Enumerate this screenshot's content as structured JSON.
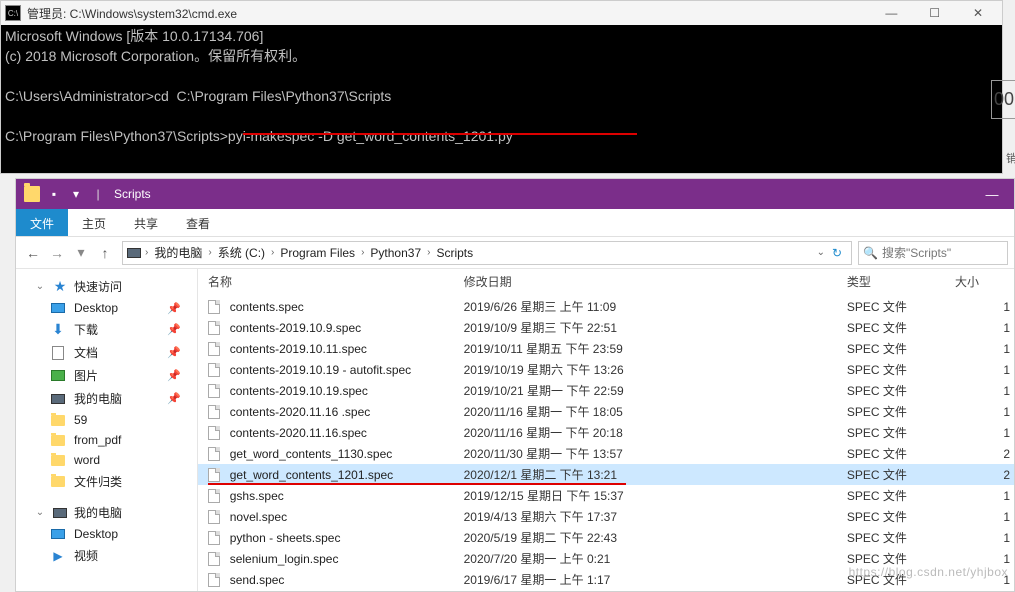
{
  "cmd": {
    "title": "管理员: C:\\Windows\\system32\\cmd.exe",
    "lines": {
      "l1": "Microsoft Windows [版本 10.0.17134.706]",
      "l2": "(c) 2018 Microsoft Corporation。保留所有权利。",
      "l3": "",
      "l4": "C:\\Users\\Administrator>cd  C:\\Program Files\\Python37\\Scripts",
      "l5": "",
      "l6": "C:\\Program Files\\Python37\\Scripts>pyi-makespec -D get_word_contents_1201.py"
    }
  },
  "right_sliver": {
    "zeros": "00",
    "undo": "销"
  },
  "explorer": {
    "title": "Scripts",
    "ribbon": {
      "file": "文件",
      "home": "主页",
      "share": "共享",
      "view": "查看"
    },
    "breadcrumb": {
      "root": "我的电脑",
      "drive": "系统 (C:)",
      "p1": "Program Files",
      "p2": "Python37",
      "p3": "Scripts"
    },
    "search_placeholder": "搜索\"Scripts\"",
    "sidebar": {
      "quick": "快速访问",
      "desktop": "Desktop",
      "downloads": "下载",
      "documents": "文档",
      "pictures": "图片",
      "mypc": "我的电脑",
      "n59": "59",
      "from_pdf": "from_pdf",
      "word": "word",
      "archive": "文件归类",
      "mypc2": "我的电脑",
      "desktop2": "Desktop",
      "video": "视频"
    },
    "columns": {
      "name": "名称",
      "date": "修改日期",
      "type": "类型",
      "size": "大小"
    },
    "files": [
      {
        "name": "contents.spec",
        "date": "2019/6/26 星期三 上午 11:09",
        "type": "SPEC 文件",
        "size": "1"
      },
      {
        "name": "contents-2019.10.9.spec",
        "date": "2019/10/9 星期三 下午 22:51",
        "type": "SPEC 文件",
        "size": "1"
      },
      {
        "name": "contents-2019.10.11.spec",
        "date": "2019/10/11 星期五 下午 23:59",
        "type": "SPEC 文件",
        "size": "1"
      },
      {
        "name": "contents-2019.10.19 - autofit.spec",
        "date": "2019/10/19 星期六 下午 13:26",
        "type": "SPEC 文件",
        "size": "1"
      },
      {
        "name": "contents-2019.10.19.spec",
        "date": "2019/10/21 星期一 下午 22:59",
        "type": "SPEC 文件",
        "size": "1"
      },
      {
        "name": "contents-2020.11.16 .spec",
        "date": "2020/11/16 星期一 下午 18:05",
        "type": "SPEC 文件",
        "size": "1"
      },
      {
        "name": "contents-2020.11.16.spec",
        "date": "2020/11/16 星期一 下午 20:18",
        "type": "SPEC 文件",
        "size": "1"
      },
      {
        "name": "get_word_contents_1130.spec",
        "date": "2020/11/30 星期一 下午 13:57",
        "type": "SPEC 文件",
        "size": "2"
      },
      {
        "name": "get_word_contents_1201.spec",
        "date": "2020/12/1 星期二 下午 13:21",
        "type": "SPEC 文件",
        "size": "2",
        "selected": true
      },
      {
        "name": "gshs.spec",
        "date": "2019/12/15 星期日 下午 15:37",
        "type": "SPEC 文件",
        "size": "1"
      },
      {
        "name": "novel.spec",
        "date": "2019/4/13 星期六 下午 17:37",
        "type": "SPEC 文件",
        "size": "1"
      },
      {
        "name": "python - sheets.spec",
        "date": "2020/5/19 星期二 下午 22:43",
        "type": "SPEC 文件",
        "size": "1"
      },
      {
        "name": "selenium_login.spec",
        "date": "2020/7/20 星期一 上午 0:21",
        "type": "SPEC 文件",
        "size": "1"
      },
      {
        "name": "send.spec",
        "date": "2019/6/17 星期一 上午 1:17",
        "type": "SPEC 文件",
        "size": "1"
      }
    ]
  },
  "watermark": "https://blog.csdn.net/yhjbox"
}
